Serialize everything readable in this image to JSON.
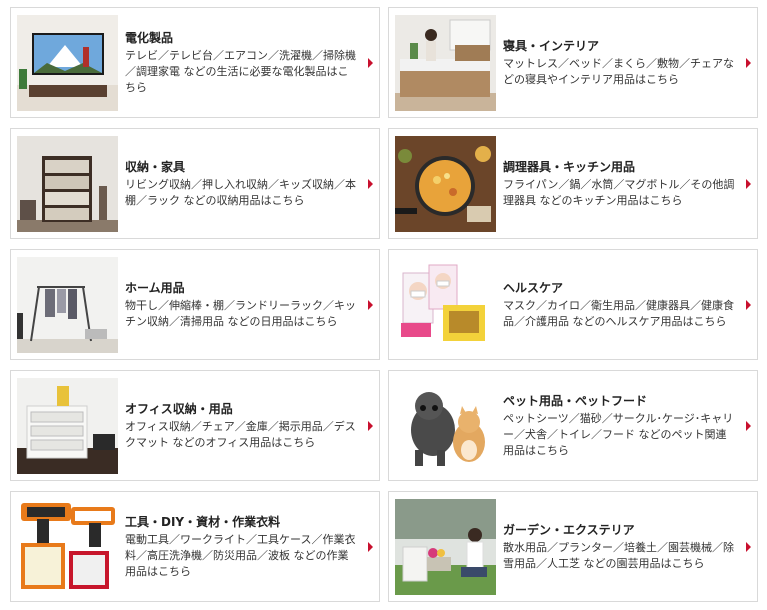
{
  "categories": [
    {
      "title": "電化製品",
      "desc": "テレビ／テレビ台／エアコン／洗濯機／掃除機／調理家電 などの生活に必要な電化製品はこちら",
      "image": "tv-mount-fuji-photo"
    },
    {
      "title": "寝具・インテリア",
      "desc": "マットレス／ベッド／まくら／敷物／チェアなどの寝具やインテリア用品はこちら",
      "image": "bedroom-photo"
    },
    {
      "title": "収納・家具",
      "desc": "リビング収納／押し入れ収納／キッズ収納／本棚／ラック などの収納用品はこちら",
      "image": "bookshelf-photo"
    },
    {
      "title": "調理器具・キッチン用品",
      "desc": "フライパン／鍋／水筒／マグボトル／その他調理器具 などのキッチン用品はこちら",
      "image": "frying-pan-photo"
    },
    {
      "title": "ホーム用品",
      "desc": "物干し／伸縮棒・棚／ランドリーラック／キッチン収納／清掃用品 などの日用品はこちら",
      "image": "clothes-rack-photo"
    },
    {
      "title": "ヘルスケア",
      "desc": "マスク／カイロ／衛生用品／健康器具／健康食品／介護用品 などのヘルスケア用品はこちら",
      "image": "mask-packages-photo"
    },
    {
      "title": "オフィス収納・用品",
      "desc": "オフィス収納／チェア／金庫／掲示用品／デスクマット などのオフィス用品はこちら",
      "image": "desk-drawer-photo"
    },
    {
      "title": "ペット用品・ペットフード",
      "desc": "ペットシーツ／猫砂／サークル･ケージ･キャリー／犬舎／トイレ／フード などのペット関連用品はこちら",
      "image": "dog-cat-photo"
    },
    {
      "title": "工具・DIY・資材・作業衣料",
      "desc": "電動工具／ワークライト／工具ケース／作業衣料／高圧洗浄機／防災用品／波板 などの作業用品はこちら",
      "image": "power-tools-photo"
    },
    {
      "title": "ガーデン・エクステリア",
      "desc": "散水用品／プランター／培養土／園芸機械／除雪用品／人工芝 などの園芸用品はこちら",
      "image": "garden-photo"
    }
  ]
}
